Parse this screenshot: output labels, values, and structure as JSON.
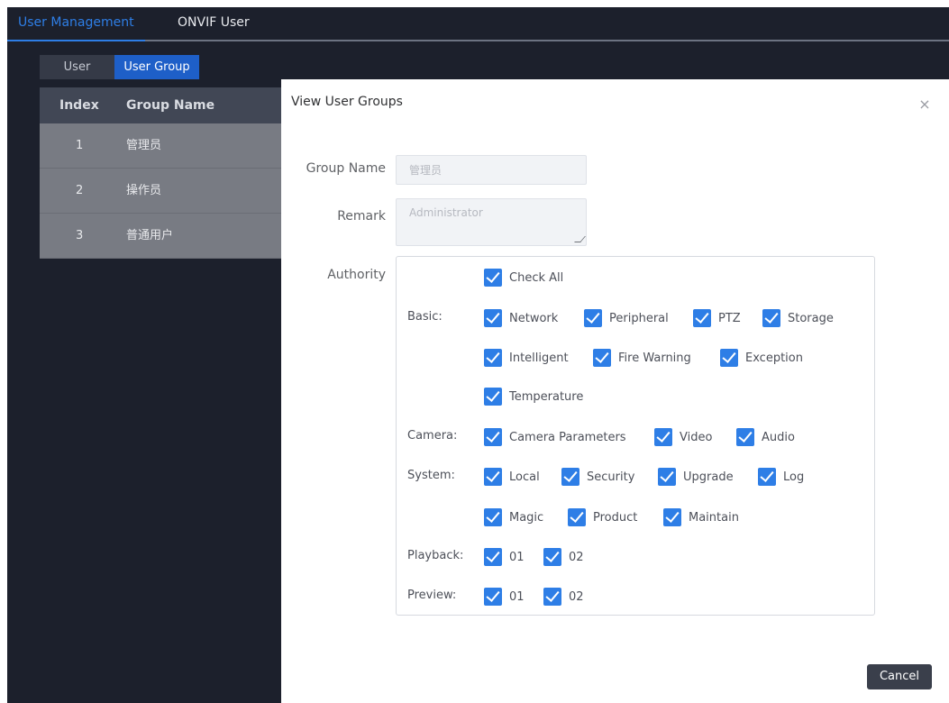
{
  "top_tabs": {
    "active": "User Management",
    "inactive": "ONVIF User"
  },
  "sub_tabs": {
    "user": "User",
    "group": "User Group"
  },
  "table": {
    "headers": {
      "index": "Index",
      "group_name": "Group Name"
    },
    "rows": [
      {
        "index": "1",
        "name": "管理员"
      },
      {
        "index": "2",
        "name": "操作员"
      },
      {
        "index": "3",
        "name": "普通用户"
      }
    ]
  },
  "modal": {
    "title": "View User Groups",
    "close_icon": "×",
    "group_name_label": "Group Name",
    "group_name_value": "管理员",
    "remark_label": "Remark",
    "remark_value": "Administrator",
    "authority_label": "Authority",
    "check_all": "Check All",
    "categories": {
      "basic": "Basic:",
      "camera": "Camera:",
      "system": "System:",
      "playback": "Playback:",
      "preview": "Preview:"
    },
    "permissions": {
      "network": "Network",
      "peripheral": "Peripheral",
      "ptz": "PTZ",
      "storage": "Storage",
      "intelligent": "Intelligent",
      "fire_warning": "Fire Warning",
      "exception": "Exception",
      "temperature": "Temperature",
      "camera_parameters": "Camera Parameters",
      "video": "Video",
      "audio": "Audio",
      "local": "Local",
      "security": "Security",
      "upgrade": "Upgrade",
      "log": "Log",
      "magic": "Magic",
      "product": "Product",
      "maintain": "Maintain",
      "playback_01": "01",
      "playback_02": "02",
      "preview_01": "01",
      "preview_02": "02"
    },
    "cancel_label": "Cancel"
  },
  "colors": {
    "accent": "#2e7ee6",
    "background": "#1c202c",
    "checkbox": "#2e7ee6"
  }
}
